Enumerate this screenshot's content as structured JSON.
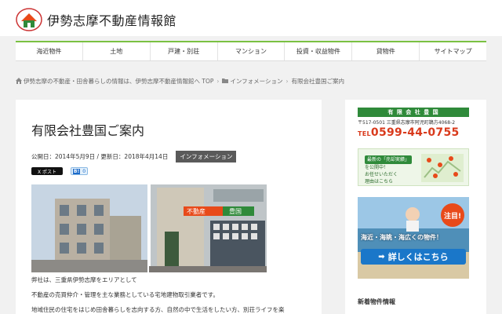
{
  "site": {
    "title": "伊勢志摩不動産情報館",
    "logo_icon": "house-logo-icon"
  },
  "nav": {
    "items": [
      {
        "label": "海近物件"
      },
      {
        "label": "土地"
      },
      {
        "label": "戸建・別荘"
      },
      {
        "label": "マンション"
      },
      {
        "label": "投資・収益物件"
      },
      {
        "label": "貸物件"
      },
      {
        "label": "サイトマップ"
      }
    ]
  },
  "breadcrumb": {
    "home": "伊勢志摩の不動産・田舎暮らしの情報は、伊勢志摩不動産情報館へ TOP",
    "category": "インフォメーション",
    "current": "有限会社豊国ご案内",
    "separator": "›"
  },
  "post": {
    "title": "有限会社豊国ご案内",
    "published": "公開日：2014年5月9日 / 更新日：2018年4月14日",
    "category": "インフォメーション",
    "share_x": "X ポスト",
    "share_hatena_b": "B!",
    "share_hatena_count": "0",
    "photo_sign": "不動産",
    "photo_sign_name": "豊国",
    "body": [
      "弊社は、三重県伊勢志摩をエリアとして",
      "不動産の売買仲介・管理を主な業務としている宅地建物取引業者です。",
      "地域住民の住宅をはじめ田舎暮らしを志向する方、自然の中で生活をしたい方、別荘ライフを楽"
    ]
  },
  "sidebar": {
    "ad1": {
      "company": "有 限 会 社 豊 国",
      "address": "〒517-0501 三重県志摩市阿児町鵜方4068-2",
      "tel_prefix": "TEL",
      "tel": "0599-44-0755"
    },
    "ad2": {
      "line1": "最新の「売却実績」",
      "line2": "を公開中！",
      "line3": "お任せいただく",
      "line4": "理由はこちら"
    },
    "ad3": {
      "badge": "注目!",
      "catch": "海近・海眺・海広くの物件！",
      "button": "詳しくはこちら",
      "arrow": "➡"
    },
    "heading": "新着物件情報"
  },
  "colors": {
    "accent": "#7ac142",
    "company_green": "#2f8a3a",
    "tel_red": "#d93a1c",
    "button_blue": "#1a77c9"
  }
}
